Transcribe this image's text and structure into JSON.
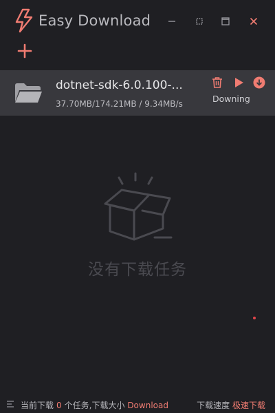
{
  "app": {
    "title": "Easy Download"
  },
  "colors": {
    "accent": "#f07c72",
    "background": "#1f1f23",
    "row_bg": "#38383d",
    "muted": "#4a4a50"
  },
  "titlebar": {
    "buttons": [
      {
        "name": "minimize",
        "icon": "minimize-icon"
      },
      {
        "name": "restore",
        "icon": "restore-icon"
      },
      {
        "name": "maximize",
        "icon": "maximize-icon"
      },
      {
        "name": "close",
        "icon": "close-icon"
      }
    ]
  },
  "toolbar": {
    "add_icon": "plus-icon"
  },
  "tasks": [
    {
      "name": "dotnet-sdk-6.0.100-...",
      "progress": "37.70MB/174.21MB / 9.34MB/s",
      "status": "Downing",
      "icon": "folder-icon",
      "actions": [
        "delete-icon",
        "play-icon",
        "download-icon"
      ]
    }
  ],
  "empty_state": {
    "text": "没有下载任务",
    "icon": "empty-box-icon"
  },
  "statusbar": {
    "current_label": "当前下载",
    "current_count": "0",
    "tasks_size_label": "个任务,下载大小",
    "size_value": "Download",
    "speed_label": "下载速度",
    "speed_value": "极速下载"
  }
}
